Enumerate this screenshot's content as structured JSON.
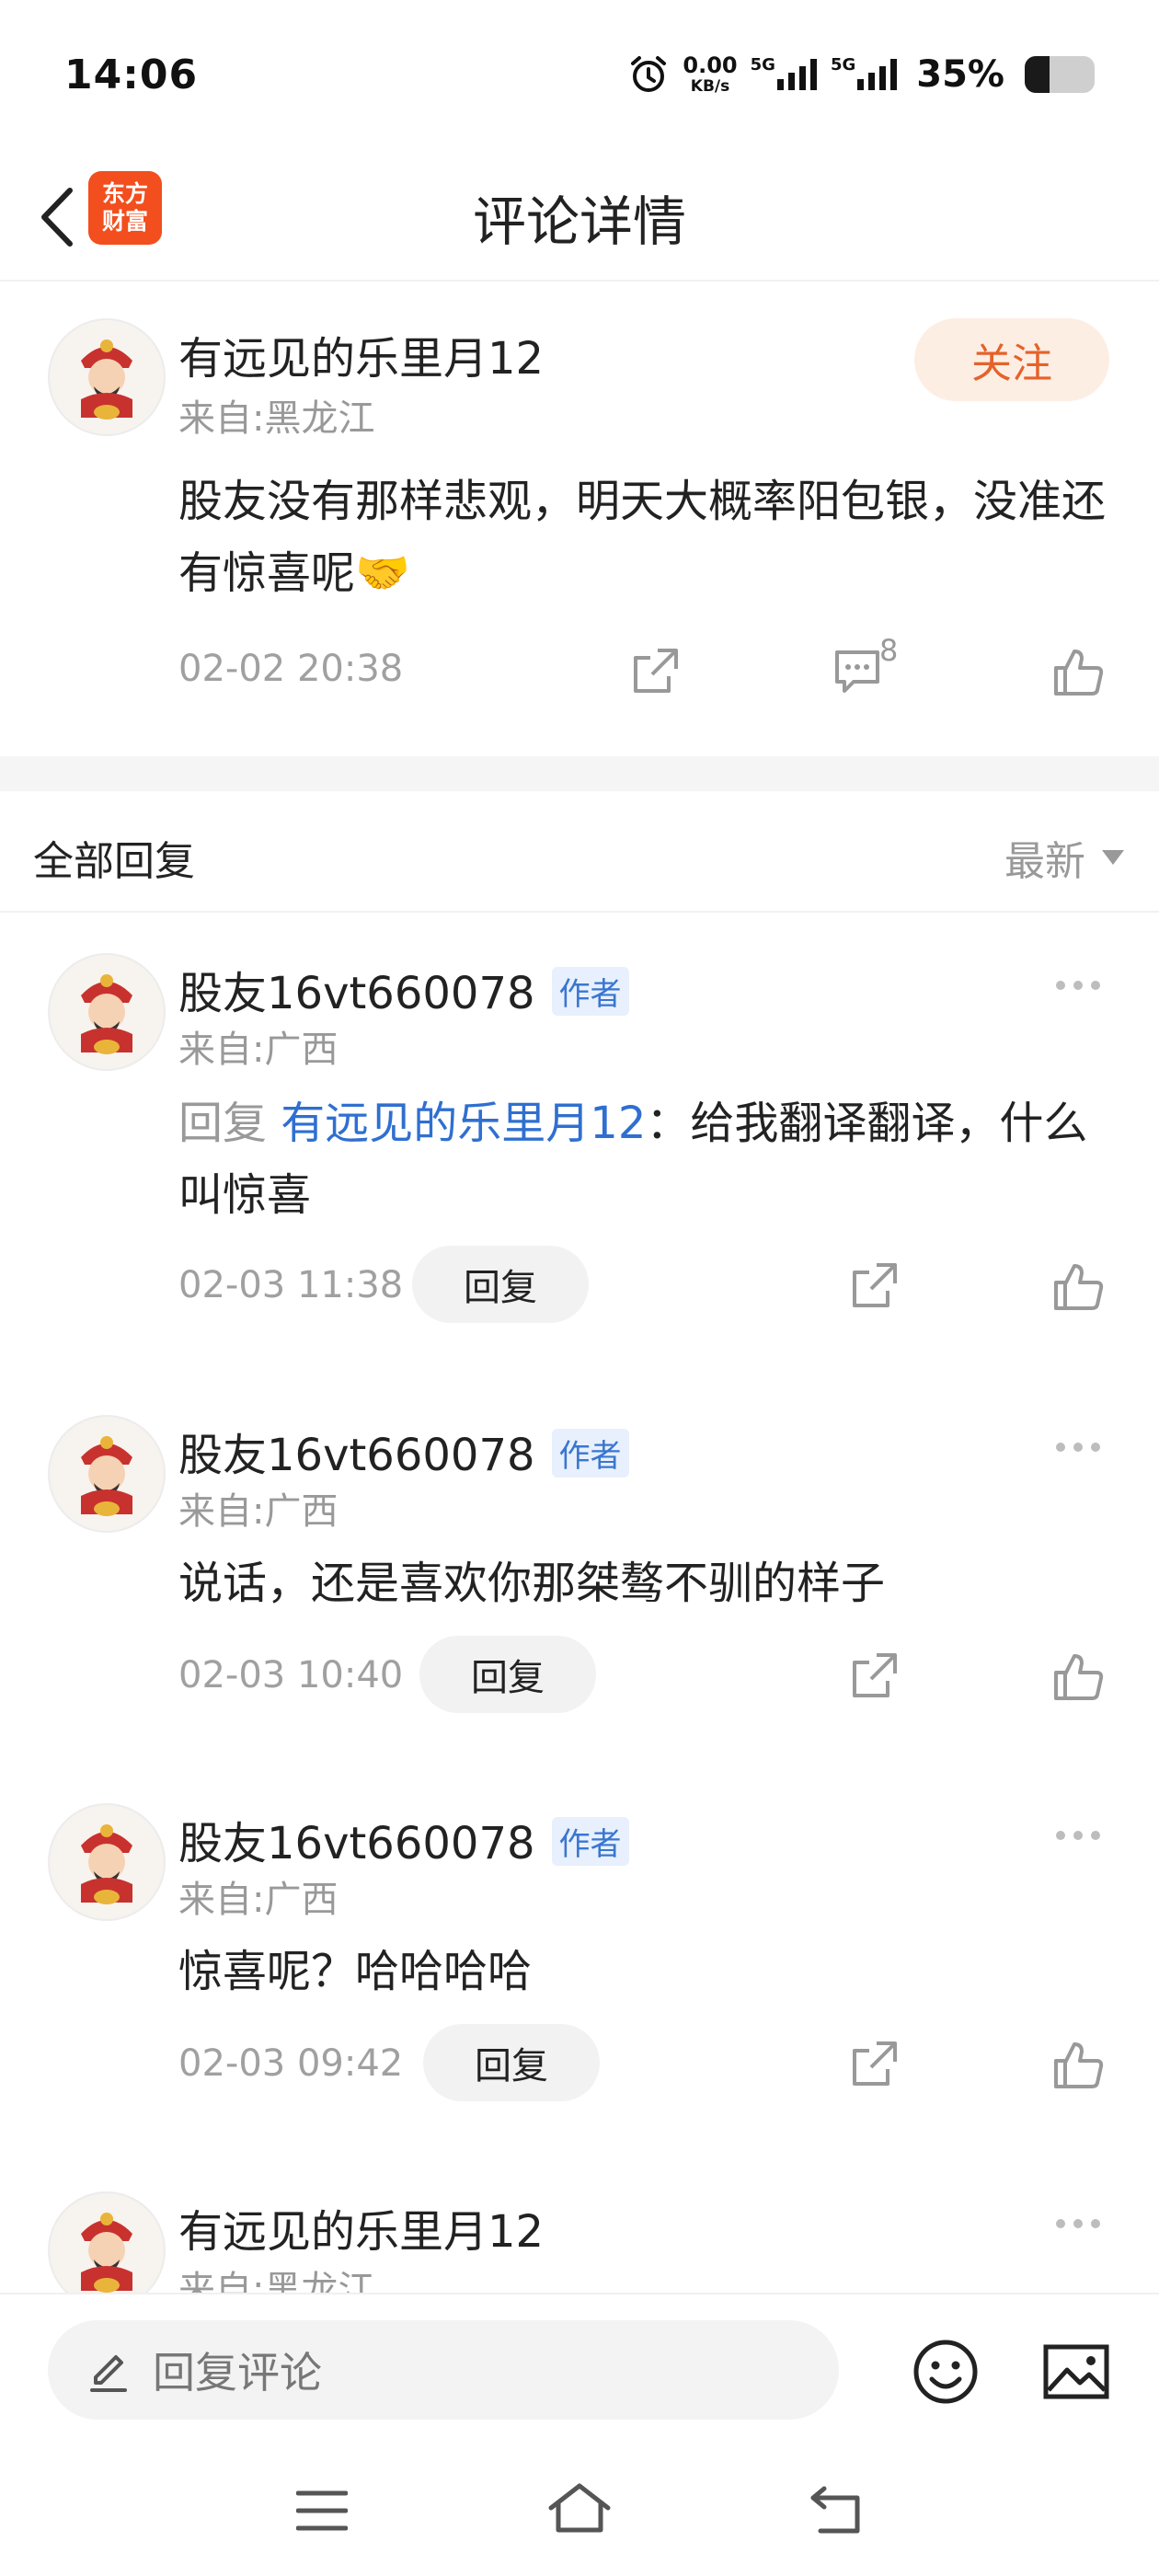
{
  "status_bar": {
    "time": "14:06",
    "speed_value": "0.00",
    "speed_unit": "KB/s",
    "network1": "5G",
    "network2": "5G",
    "battery_percent": "35%",
    "battery_level": 0.35
  },
  "nav": {
    "title": "评论详情",
    "logo_line1": "东方",
    "logo_line2": "财富"
  },
  "main_comment": {
    "username": "有远见的乐里月12",
    "source": "来自:黑龙江",
    "follow_label": "关注",
    "text": "股友没有那样悲观，明天大概率阳包银，没准还有惊喜呢🤝",
    "timestamp": "02-02 20:38",
    "comment_count": "8"
  },
  "section": {
    "title": "全部回复",
    "sort_label": "最新"
  },
  "replies": [
    {
      "username": "股友16vt660078",
      "tag": "作者",
      "source": "来自:广西",
      "prefix": "回复",
      "mention": "有远见的乐里月12",
      "text": "：给我翻译翻译，什么叫惊喜",
      "timestamp": "02-03 11:38",
      "reply_label": "回复"
    },
    {
      "username": "股友16vt660078",
      "tag": "作者",
      "source": "来自:广西",
      "text": "说话，还是喜欢你那桀骜不驯的样子",
      "timestamp": "02-03 10:40",
      "reply_label": "回复"
    },
    {
      "username": "股友16vt660078",
      "tag": "作者",
      "source": "来自:广西",
      "text": "惊喜呢？哈哈哈哈",
      "timestamp": "02-03 09:42",
      "reply_label": "回复"
    },
    {
      "username": "有远见的乐里月12",
      "source": "来自:黑龙江"
    }
  ],
  "bottom_bar": {
    "placeholder": "回复评论"
  },
  "icons": {
    "back": "chevron-left-icon",
    "share": "share-icon",
    "comment": "comment-icon",
    "like": "thumbs-up-icon",
    "more": "more-dots-icon",
    "edit": "pencil-icon",
    "emoji": "emoji-icon",
    "image": "image-icon",
    "menu": "menu-icon",
    "home": "home-icon",
    "return": "back-arrow-icon"
  },
  "colors": {
    "accent": "#e5622a",
    "follow_bg": "#fdeee4",
    "link": "#2f6fd0",
    "logo": "#f24e1e"
  }
}
